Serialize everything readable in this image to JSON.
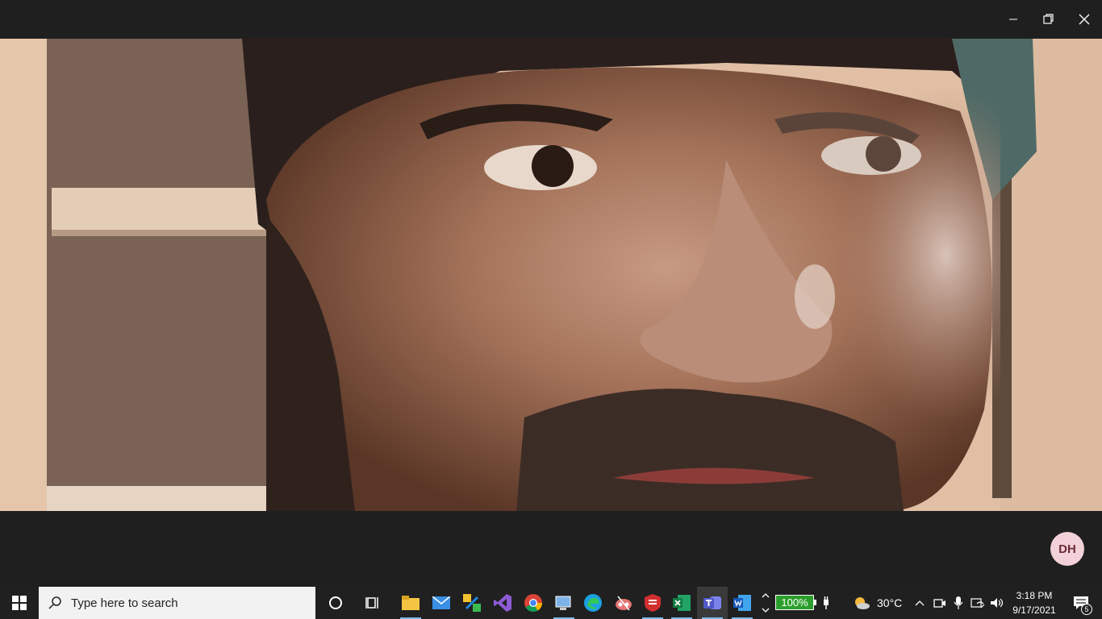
{
  "window": {
    "controls": {
      "minimize": "minimize-icon",
      "restore": "restore-icon",
      "close": "close-icon"
    }
  },
  "video": {
    "description_icon": "participant-video-feed"
  },
  "participant": {
    "initials": "DH",
    "avatar_color": "#f3d1d8"
  },
  "taskbar": {
    "search_placeholder": "Type here to search",
    "battery_percent": "100%",
    "temperature": "30°C",
    "time": "3:18 PM",
    "date": "9/17/2021",
    "notification_count": "5",
    "accent": "#76b9ed"
  }
}
